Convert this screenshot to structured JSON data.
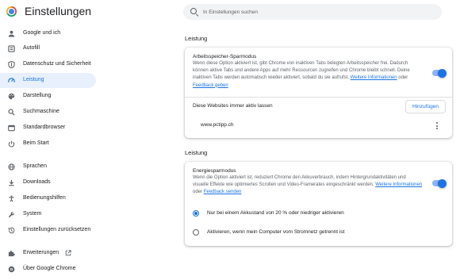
{
  "app": {
    "title": "Einstellungen"
  },
  "search": {
    "placeholder": "In Einstellungen suchen"
  },
  "sidebar": {
    "items": [
      {
        "label": "Google und ich",
        "icon": "person-icon"
      },
      {
        "label": "Autofill",
        "icon": "autofill-icon"
      },
      {
        "label": "Datenschutz und Sicherheit",
        "icon": "shield-icon"
      },
      {
        "label": "Leistung",
        "icon": "speedometer-icon",
        "active": true
      },
      {
        "label": "Darstellung",
        "icon": "palette-icon"
      },
      {
        "label": "Suchmaschine",
        "icon": "search-icon"
      },
      {
        "label": "Standardbrowser",
        "icon": "browser-icon"
      },
      {
        "label": "Beim Start",
        "icon": "power-icon"
      },
      {
        "label": "Sprachen",
        "icon": "globe-icon"
      },
      {
        "label": "Downloads",
        "icon": "download-icon"
      },
      {
        "label": "Bedienungshilfen",
        "icon": "accessibility-icon"
      },
      {
        "label": "System",
        "icon": "wrench-icon"
      },
      {
        "label": "Einstellungen zurücksetzen",
        "icon": "history-icon"
      },
      {
        "label": "Erweiterungen",
        "icon": "puzzle-icon"
      },
      {
        "label": "Über Google Chrome",
        "icon": "chrome-icon"
      }
    ]
  },
  "main": {
    "section1": {
      "title": "Leistung",
      "memory": {
        "title": "Arbeitsspeicher-Sparmodus",
        "desc": "Wenn diese Option aktiviert ist, gibt Chrome von inaktiven Tabs belegten Arbeitsspeicher frei. Dadurch können aktive Tabs und andere Apps auf mehr Ressourcen zugreifen und Chrome bleibt schnell. Deine inaktiven Tabs werden automatisch wieder aktiviert, sobald du sie aufrufst.",
        "link": "Weitere Informationen",
        "or": "oder",
        "feedback": "Feedback geben",
        "enabled": true
      },
      "always_active": {
        "label": "Diese Websites immer aktiv lassen",
        "button": "Hinzufügen"
      },
      "site": "www.pctipp.ch"
    },
    "section2": {
      "title": "Leistung",
      "energy": {
        "title": "Energiesparmodus",
        "desc": "Wenn die Option aktiviert ist, reduziert Chrome den Akkuverbrauch, indem Hintergrundaktivitäten und visuelle Effekte wie optimiertes Scrollen und Video-Framerates eingeschränkt werden.",
        "link": "Weitere Informationen",
        "or": "oder",
        "feedback": "Feedback senden",
        "enabled": true
      },
      "options": [
        {
          "label": "Nur bei einem Akkustand von 20 % oder niedriger aktivieren",
          "checked": true
        },
        {
          "label": "Aktivieren, wenn mein Computer vom Stromnetz getrennt ist",
          "checked": false
        }
      ]
    }
  },
  "colors": {
    "accent": "#1a73e8",
    "active_bg": "#e8f0fe",
    "toggle_track": "#8ab4f8"
  }
}
